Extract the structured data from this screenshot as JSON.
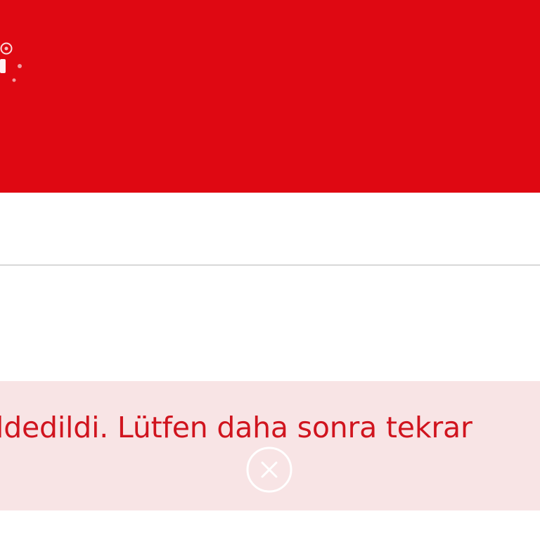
{
  "header": {
    "background_color": "#df0812",
    "logo_icon": "brand-logo-icon"
  },
  "alert": {
    "message": "ldedildi. Lütfen daha sonra tekrar",
    "background_color": "#f8e4e5",
    "text_color": "#d0141e",
    "dismiss_icon": "close-circle-icon"
  }
}
